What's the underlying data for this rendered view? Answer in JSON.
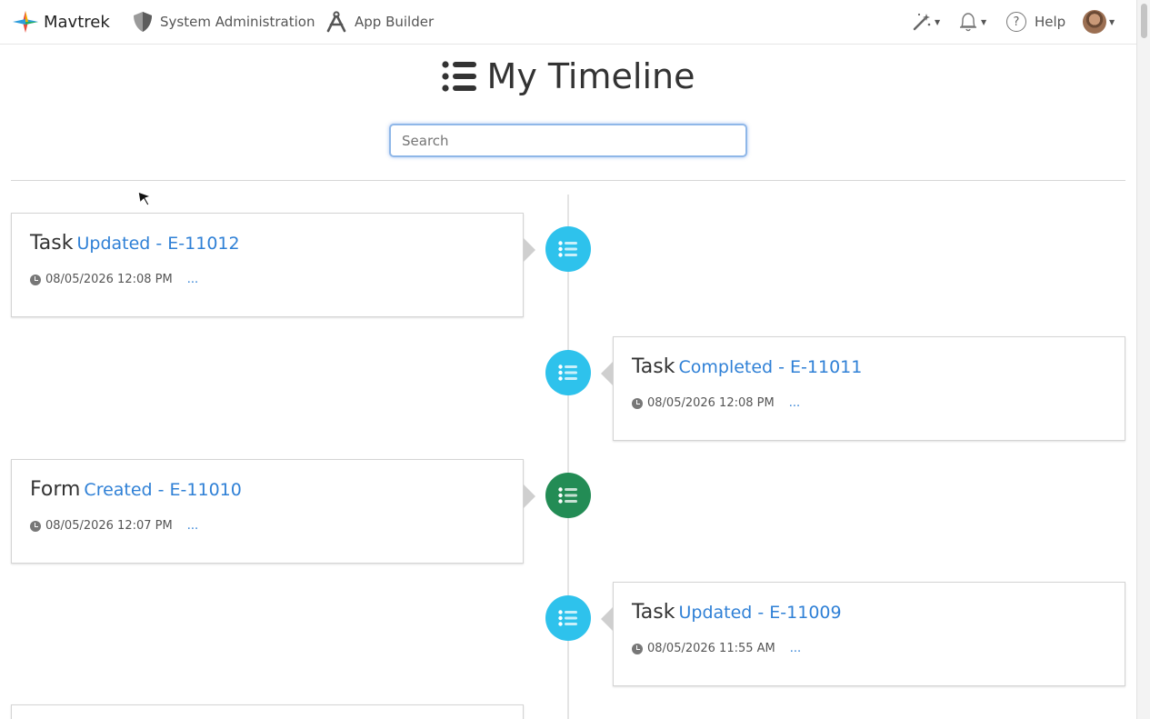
{
  "nav": {
    "brand": "Mavtrek",
    "system_administration": "System Administration",
    "app_builder": "App Builder",
    "help": "Help"
  },
  "icons": {
    "brand": "mavtrek-compass-icon",
    "system_administration": "shield-icon",
    "app_builder": "compass-tool-icon",
    "magic": "magic-wand-icon",
    "notifications": "bell-icon",
    "help": "help-circle-icon",
    "user": "avatar",
    "title": "list-icon",
    "event": "list-icon",
    "timestamp": "clock-icon"
  },
  "page": {
    "title": "My Timeline",
    "search_placeholder": "Search"
  },
  "colors": {
    "task_badge": "#2ec2ec",
    "form_badge": "#238c55",
    "link": "#2f80d6"
  },
  "timeline": [
    {
      "type": "Task",
      "action": "Updated - E-11012",
      "timestamp": "08/05/2026 12:08 PM",
      "more": "..."
    },
    {
      "type": "Task",
      "action": "Completed - E-11011",
      "timestamp": "08/05/2026 12:08 PM",
      "more": "..."
    },
    {
      "type": "Form",
      "action": "Created - E-11010",
      "timestamp": "08/05/2026 12:07 PM",
      "more": "..."
    },
    {
      "type": "Task",
      "action": "Updated - E-11009",
      "timestamp": "08/05/2026 11:55 AM",
      "more": "..."
    }
  ]
}
